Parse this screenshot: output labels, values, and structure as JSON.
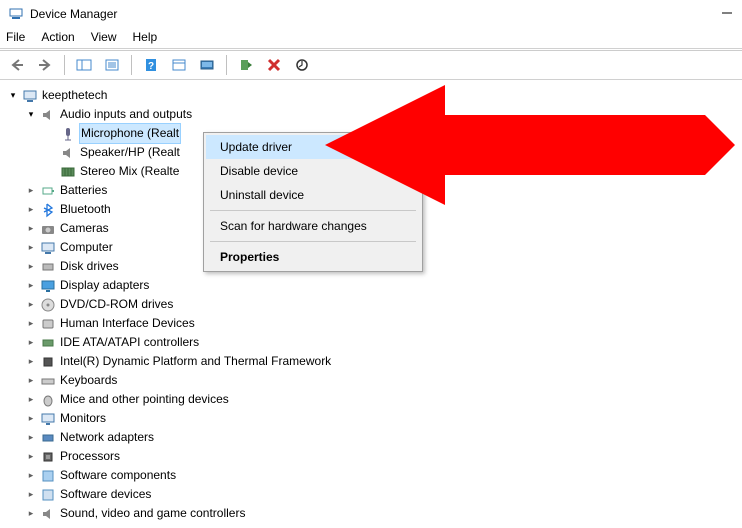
{
  "title": "Device Manager",
  "menubar": {
    "file": "File",
    "action": "Action",
    "view": "View",
    "help": "Help"
  },
  "root": "keepthetech",
  "categories": {
    "audio": "Audio inputs and outputs",
    "audio_children": {
      "microphone": "Microphone (Realt",
      "speaker": "Speaker/HP (Realt",
      "stereomix": "Stereo Mix (Realte"
    },
    "batteries": "Batteries",
    "bluetooth": "Bluetooth",
    "cameras": "Cameras",
    "computer": "Computer",
    "disk": "Disk drives",
    "display": "Display adapters",
    "dvd": "DVD/CD-ROM drives",
    "hid": "Human Interface Devices",
    "ide": "IDE ATA/ATAPI controllers",
    "intel": "Intel(R) Dynamic Platform and Thermal Framework",
    "keyboards": "Keyboards",
    "mice": "Mice and other pointing devices",
    "monitors": "Monitors",
    "network": "Network adapters",
    "processors": "Processors",
    "swcomp": "Software components",
    "swdev": "Software devices",
    "sound": "Sound, video and game controllers"
  },
  "context_menu": {
    "update": "Update driver",
    "disable": "Disable device",
    "uninstall": "Uninstall device",
    "scan": "Scan for hardware changes",
    "properties": "Properties"
  }
}
